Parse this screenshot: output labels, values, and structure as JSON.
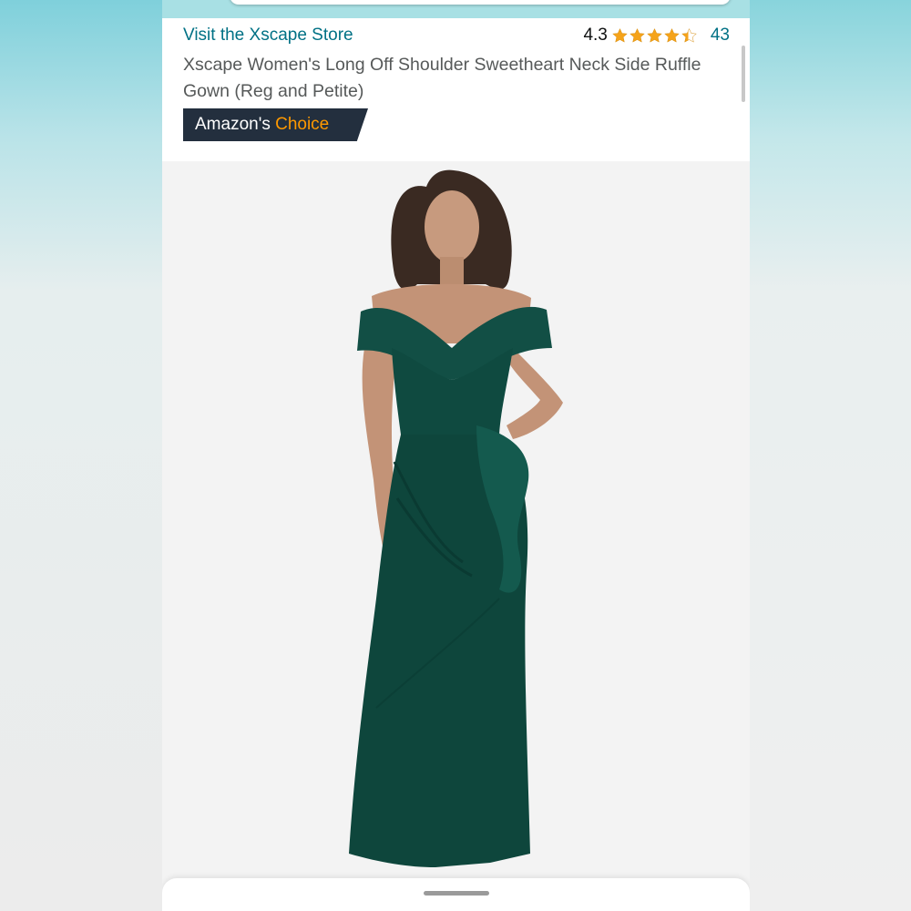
{
  "header": {
    "store_link": "Visit the Xscape Store",
    "rating_value": "4.3",
    "rating_stars": 4.3,
    "rating_count": "43",
    "title": "Xscape Women's Long Off Shoulder Sweetheart Neck Side Ruffle Gown (Reg and Petite)",
    "badge_prefix": "Amazon's",
    "badge_choice": "Choice"
  },
  "colors": {
    "link": "#007185",
    "star": "#f5a31a",
    "badge_bg": "#232f3e",
    "badge_accent": "#ff9900",
    "dress": "#0f4a40"
  },
  "image": {
    "icon": "product-photo-green-gown"
  }
}
